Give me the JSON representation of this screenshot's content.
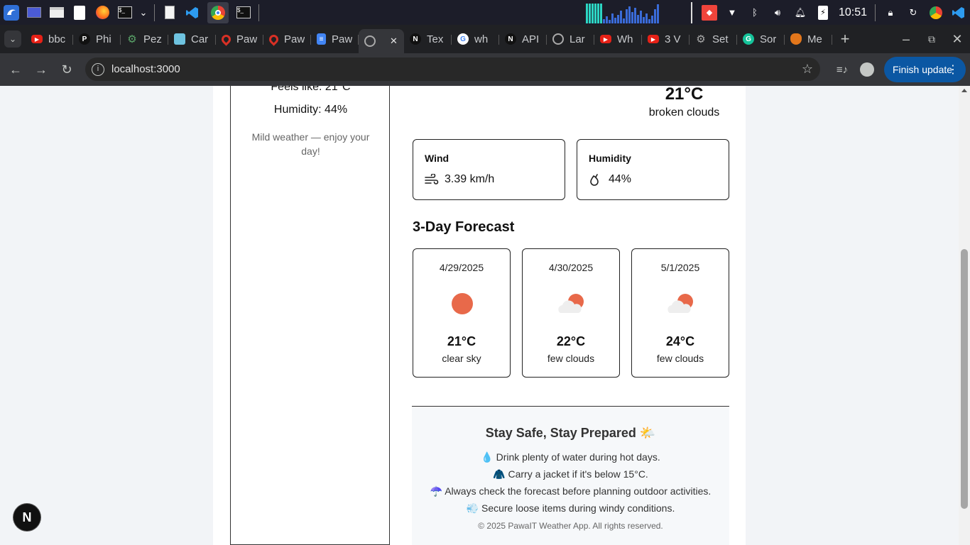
{
  "taskbar": {
    "time": "10:51"
  },
  "tabs": [
    {
      "label": "bbc",
      "fav": "youtube-icon",
      "color": "#e62117"
    },
    {
      "label": "Phi",
      "fav": "P",
      "color": "#111"
    },
    {
      "label": "Pez",
      "fav": "gear-icon",
      "color": "#5aa469"
    },
    {
      "label": "Car",
      "fav": "grid-icon",
      "color": "#6ec3e0"
    },
    {
      "label": "Paw",
      "fav": "pin-icon",
      "color": "#d93025"
    },
    {
      "label": "Paw",
      "fav": "pin-icon",
      "color": "#d93025"
    },
    {
      "label": "Paw",
      "fav": "doc-icon",
      "color": "#4285f4"
    },
    {
      "label": "",
      "fav": "globe-icon",
      "color": "#aaa",
      "active": true
    },
    {
      "label": "Tex",
      "fav": "N",
      "color": "#111"
    },
    {
      "label": "wh",
      "fav": "G",
      "color": "#fff"
    },
    {
      "label": "API",
      "fav": "N",
      "color": "#111"
    },
    {
      "label": "Lar",
      "fav": "globe-icon",
      "color": "#aaa"
    },
    {
      "label": "Wh",
      "fav": "youtube-icon",
      "color": "#e62117"
    },
    {
      "label": "3 V",
      "fav": "youtube-icon",
      "color": "#e62117"
    },
    {
      "label": "Set",
      "fav": "gear-icon",
      "color": "#aaa"
    },
    {
      "label": "Sor",
      "fav": "G",
      "color": "#15c39a"
    },
    {
      "label": "Me",
      "fav": "fox-icon",
      "color": "#e2761b"
    }
  ],
  "toolbar": {
    "url": "localhost:3000",
    "finish_update": "Finish update"
  },
  "left": {
    "feels_like": "Feels like: 21°C",
    "humidity": "Humidity: 44%",
    "message": "Mild weather — enjoy your day!"
  },
  "current": {
    "temp": "21°C",
    "desc": "broken clouds"
  },
  "wind": {
    "title": "Wind",
    "value": "3.39 km/h"
  },
  "humidity": {
    "title": "Humidity",
    "value": "44%"
  },
  "forecast_title": "3-Day Forecast",
  "forecast": [
    {
      "date": "4/29/2025",
      "temp": "21°C",
      "desc": "clear sky",
      "icon": "sun-icon"
    },
    {
      "date": "4/30/2025",
      "temp": "22°C",
      "desc": "few clouds",
      "icon": "cloud-sun-icon"
    },
    {
      "date": "5/1/2025",
      "temp": "24°C",
      "desc": "few clouds",
      "icon": "cloud-sun-icon"
    }
  ],
  "tips": {
    "title": "Stay Safe, Stay Prepared 🌤️",
    "items": [
      "💧 Drink plenty of water during hot days.",
      "🧥 Carry a jacket if it's below 15°C.",
      "☂️ Always check the forecast before planning outdoor activities.",
      "💨 Secure loose items during windy conditions."
    ],
    "footer": "© 2025 PawaIT Weather App. All rights reserved."
  },
  "next_badge": "N",
  "colors": {
    "accent": "#e8694a",
    "cloud": "#eeeeee",
    "button": "#0b57a3"
  }
}
